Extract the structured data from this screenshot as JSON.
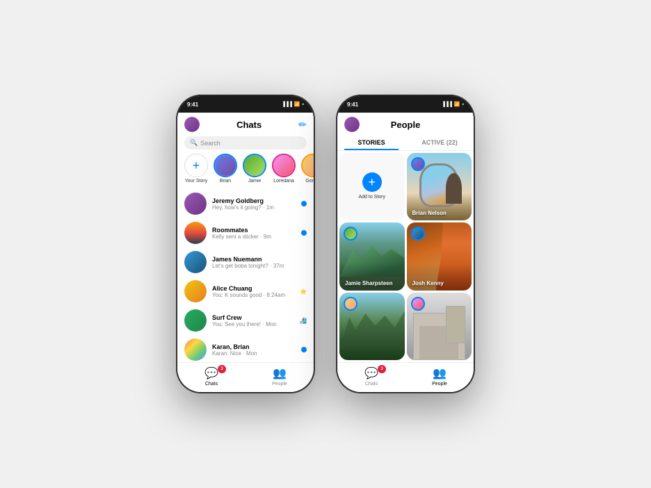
{
  "page": {
    "background": "#f0f0f0"
  },
  "phone1": {
    "status": {
      "time": "9:41",
      "signal": "▐▐▐",
      "wifi": "WiFi",
      "battery": "🔋"
    },
    "header": {
      "title": "Chats",
      "compose_icon": "✏"
    },
    "search": {
      "placeholder": "Search"
    },
    "stories": [
      {
        "label": "Your Story",
        "type": "add"
      },
      {
        "label": "Brian",
        "type": "story"
      },
      {
        "label": "Jamie",
        "type": "story"
      },
      {
        "label": "Loredana",
        "type": "story"
      },
      {
        "label": "Gord...",
        "type": "story"
      }
    ],
    "chats": [
      {
        "name": "Jeremy Goldberg",
        "preview": "Hey, how's it going? · 1m",
        "unread": true,
        "avatar": "purple"
      },
      {
        "name": "Roommates",
        "preview": "Kelly sent a sticker · 9m",
        "unread": true,
        "avatar": "golden-gate"
      },
      {
        "name": "James Nuemann",
        "preview": "Let's get boba tonight? · 37m",
        "unread": false,
        "avatar": "blue"
      },
      {
        "name": "Alice Chuang",
        "preview": "You: K sounds good · 8:24am",
        "unread": false,
        "avatar": "yellow",
        "emoji": "🌟"
      },
      {
        "name": "Surf Crew",
        "preview": "You: See you there! · Mon",
        "unread": false,
        "avatar": "green",
        "emoji": "🏄‍♀️🏄"
      },
      {
        "name": "Karan, Brian",
        "preview": "Karan: Nice · Mon",
        "unread": true,
        "avatar": "multi"
      }
    ],
    "nav": {
      "items": [
        {
          "label": "Chats",
          "icon": "💬",
          "active": true,
          "badge": "3"
        },
        {
          "label": "People",
          "icon": "👥",
          "active": false
        }
      ]
    }
  },
  "phone2": {
    "status": {
      "time": "9:41",
      "signal": "▐▐▐",
      "wifi": "WiFi",
      "battery": "🔋"
    },
    "header": {
      "title": "People"
    },
    "tabs": [
      {
        "label": "STORIES",
        "active": true
      },
      {
        "label": "ACTIVE (22)",
        "active": false
      }
    ],
    "stories": [
      {
        "type": "add",
        "label": "Add to Story"
      },
      {
        "name": "Brian Nelson",
        "bg": "airplane",
        "has_avatar": true
      },
      {
        "name": "Jamie Sharpsteen",
        "bg": "mountains",
        "has_avatar": true
      },
      {
        "name": "Josh Kenny",
        "bg": "canyon",
        "has_avatar": true
      },
      {
        "name": "",
        "bg": "forest",
        "has_avatar": true
      },
      {
        "name": "",
        "bg": "building",
        "has_avatar": true
      }
    ],
    "nav": {
      "items": [
        {
          "label": "Chats",
          "icon": "💬",
          "active": false,
          "badge": "3"
        },
        {
          "label": "People",
          "icon": "👥",
          "active": true
        }
      ]
    }
  }
}
